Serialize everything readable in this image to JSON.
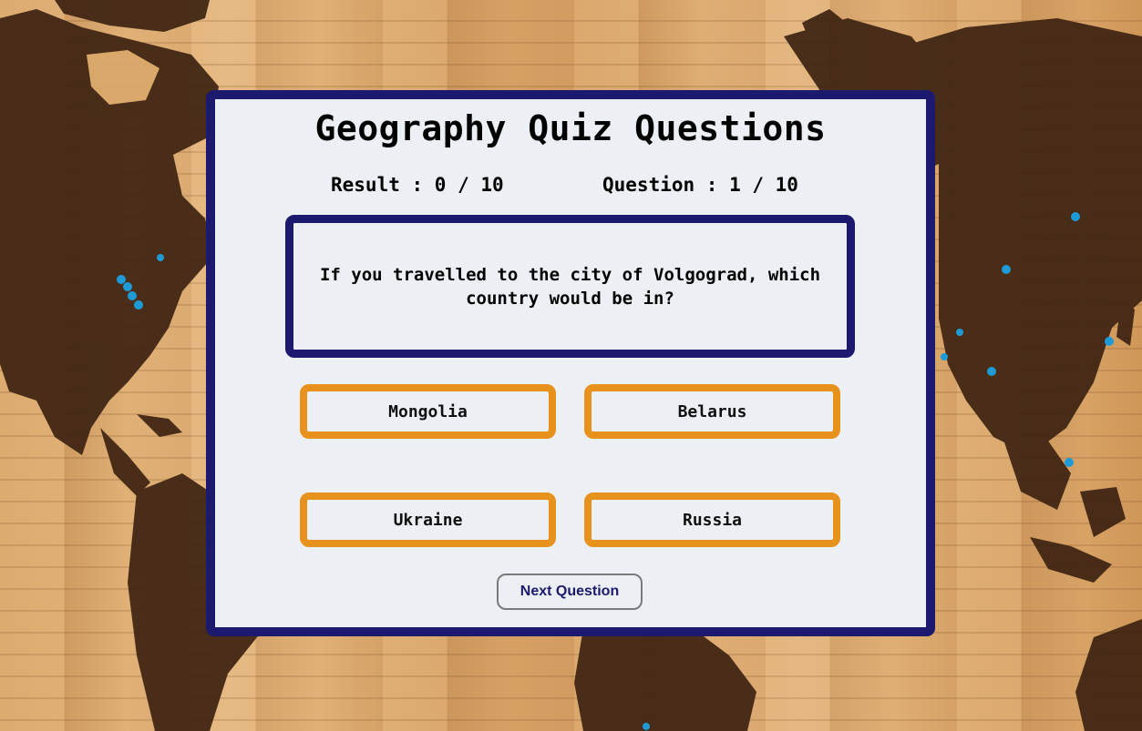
{
  "quiz": {
    "title": "Geography Quiz Questions",
    "result_text": "Result : 0 / 10",
    "question_count_text": "Question : 1 / 10",
    "question": "If you travelled to the city of Volgograd, which country would be in?",
    "answers": [
      "Mongolia",
      "Belarus",
      "Ukraine",
      "Russia"
    ],
    "next_label": "Next Question"
  },
  "colors": {
    "card_background": "#ecf0f4",
    "card_border": "#1c1a6e",
    "answer_border": "#e8921e",
    "next_text": "#1c1a6e",
    "map_pins": "#1e9bd7"
  }
}
